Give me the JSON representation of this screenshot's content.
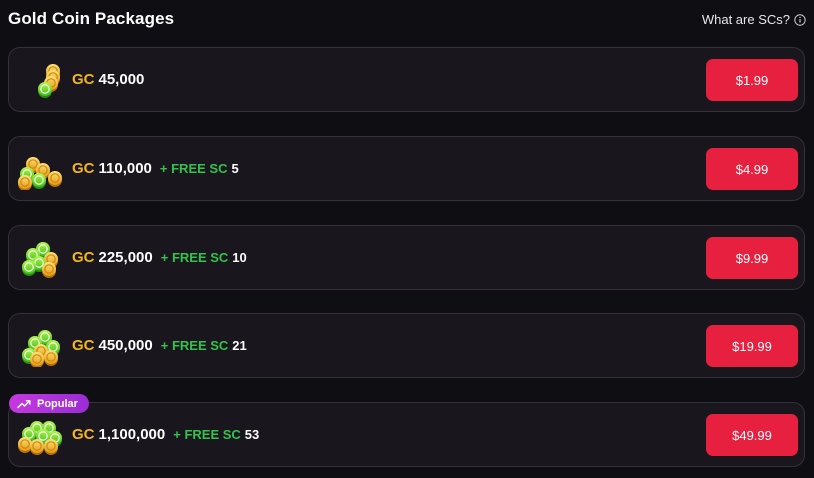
{
  "header": {
    "title": "Gold Coin Packages",
    "help_link": "What are SCs?",
    "help_icon": "info-icon"
  },
  "colors": {
    "background": "#0f0e12",
    "card": "#19171d",
    "card_border": "#34313a",
    "gc_label": "#f2b522",
    "free_sc_label": "#32c24d",
    "price_button": "#e7203f",
    "popular_badge": "#b535dc"
  },
  "packages": [
    {
      "icon": "coin-stack-icon",
      "gc_label": "GC",
      "gc_amount": "45,000",
      "bonus_label": "",
      "bonus_amount": "",
      "price": "$1.99",
      "badge": ""
    },
    {
      "icon": "coin-pile-icon",
      "gc_label": "GC",
      "gc_amount": "110,000",
      "bonus_label": "+ FREE SC",
      "bonus_amount": "5",
      "price": "$4.99",
      "badge": ""
    },
    {
      "icon": "coin-pile-icon",
      "gc_label": "GC",
      "gc_amount": "225,000",
      "bonus_label": "+ FREE SC",
      "bonus_amount": "10",
      "price": "$9.99",
      "badge": ""
    },
    {
      "icon": "coin-pile-icon",
      "gc_label": "GC",
      "gc_amount": "450,000",
      "bonus_label": "+ FREE SC",
      "bonus_amount": "21",
      "price": "$19.99",
      "badge": ""
    },
    {
      "icon": "coin-heap-icon",
      "gc_label": "GC",
      "gc_amount": "1,100,000",
      "bonus_label": "+ FREE SC",
      "bonus_amount": "53",
      "price": "$49.99",
      "badge": "Popular",
      "badge_icon": "trending-up-icon"
    }
  ]
}
